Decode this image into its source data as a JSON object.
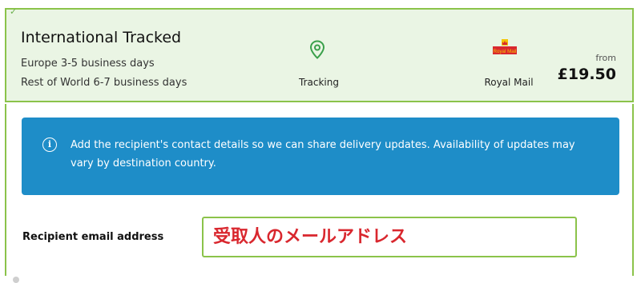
{
  "shipping_option": {
    "title": "International Tracked",
    "lines": [
      "Europe 3-5 business days",
      "Rest of World 6-7 business days"
    ],
    "feature": {
      "icon": "location-pin-icon",
      "label": "Tracking"
    },
    "carrier": {
      "logo_text": "Royal Mail",
      "label": "Royal Mail"
    },
    "price_prefix": "from",
    "price": "£19.50",
    "selected": true,
    "check_icon": "checkmark-icon",
    "colors": {
      "accent": "#8bc34a",
      "background": "#eaf5e4"
    }
  },
  "info": {
    "icon": "info-icon",
    "text": "Add the recipient's contact details so we can share delivery updates. Availability of updates may vary by destination country.",
    "color": "#1e8dc8"
  },
  "recipient": {
    "email_label": "Recipient email address",
    "email_placeholder": "受取人のメールアドレス",
    "placeholder_color": "#d9272e"
  }
}
